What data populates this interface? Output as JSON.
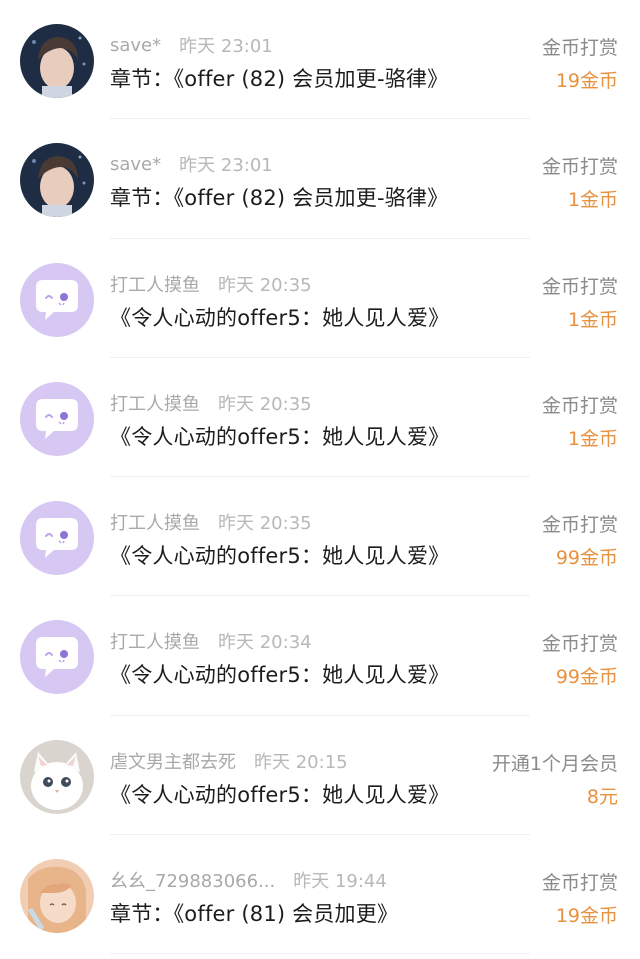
{
  "rows": [
    {
      "user": "save*",
      "time": "昨天 23:01",
      "title": "章节：《offer (82) 会员加更-骆律》",
      "type": "金币打赏",
      "amount": "19金币",
      "avatar": "photo-young-man-avatar"
    },
    {
      "user": "save*",
      "time": "昨天 23:01",
      "title": "章节：《offer (82) 会员加更-骆律》",
      "type": "金币打赏",
      "amount": "1金币",
      "avatar": "photo-young-man-avatar"
    },
    {
      "user": "打工人摸鱼",
      "time": "昨天 20:35",
      "title": "《令人心动的offer5：她人见人爱》",
      "type": "金币打赏",
      "amount": "1金币",
      "avatar": "default-chat-bubble-avatar"
    },
    {
      "user": "打工人摸鱼",
      "time": "昨天 20:35",
      "title": "《令人心动的offer5：她人见人爱》",
      "type": "金币打赏",
      "amount": "1金币",
      "avatar": "default-chat-bubble-avatar"
    },
    {
      "user": "打工人摸鱼",
      "time": "昨天 20:35",
      "title": "《令人心动的offer5：她人见人爱》",
      "type": "金币打赏",
      "amount": "99金币",
      "avatar": "default-chat-bubble-avatar"
    },
    {
      "user": "打工人摸鱼",
      "time": "昨天 20:34",
      "title": "《令人心动的offer5：她人见人爱》",
      "type": "金币打赏",
      "amount": "99金币",
      "avatar": "default-chat-bubble-avatar"
    },
    {
      "user": "虐文男主都去死",
      "time": "昨天 20:15",
      "title": "《令人心动的offer5：她人见人爱》",
      "type": "开通1个月会员",
      "amount": "8元",
      "avatar": "white-kitten-avatar"
    },
    {
      "user": "幺幺_729883066...",
      "time": "昨天 19:44",
      "title": "章节：《offer (81) 会员加更》",
      "type": "金币打赏",
      "amount": "19金币",
      "avatar": "anime-girl-avatar"
    }
  ],
  "colors": {
    "amount": "#e8913f",
    "default_avatar_bg": "#d6c8f3",
    "meta_text": "#a9a9a9",
    "title_text": "#1c1c1c"
  }
}
